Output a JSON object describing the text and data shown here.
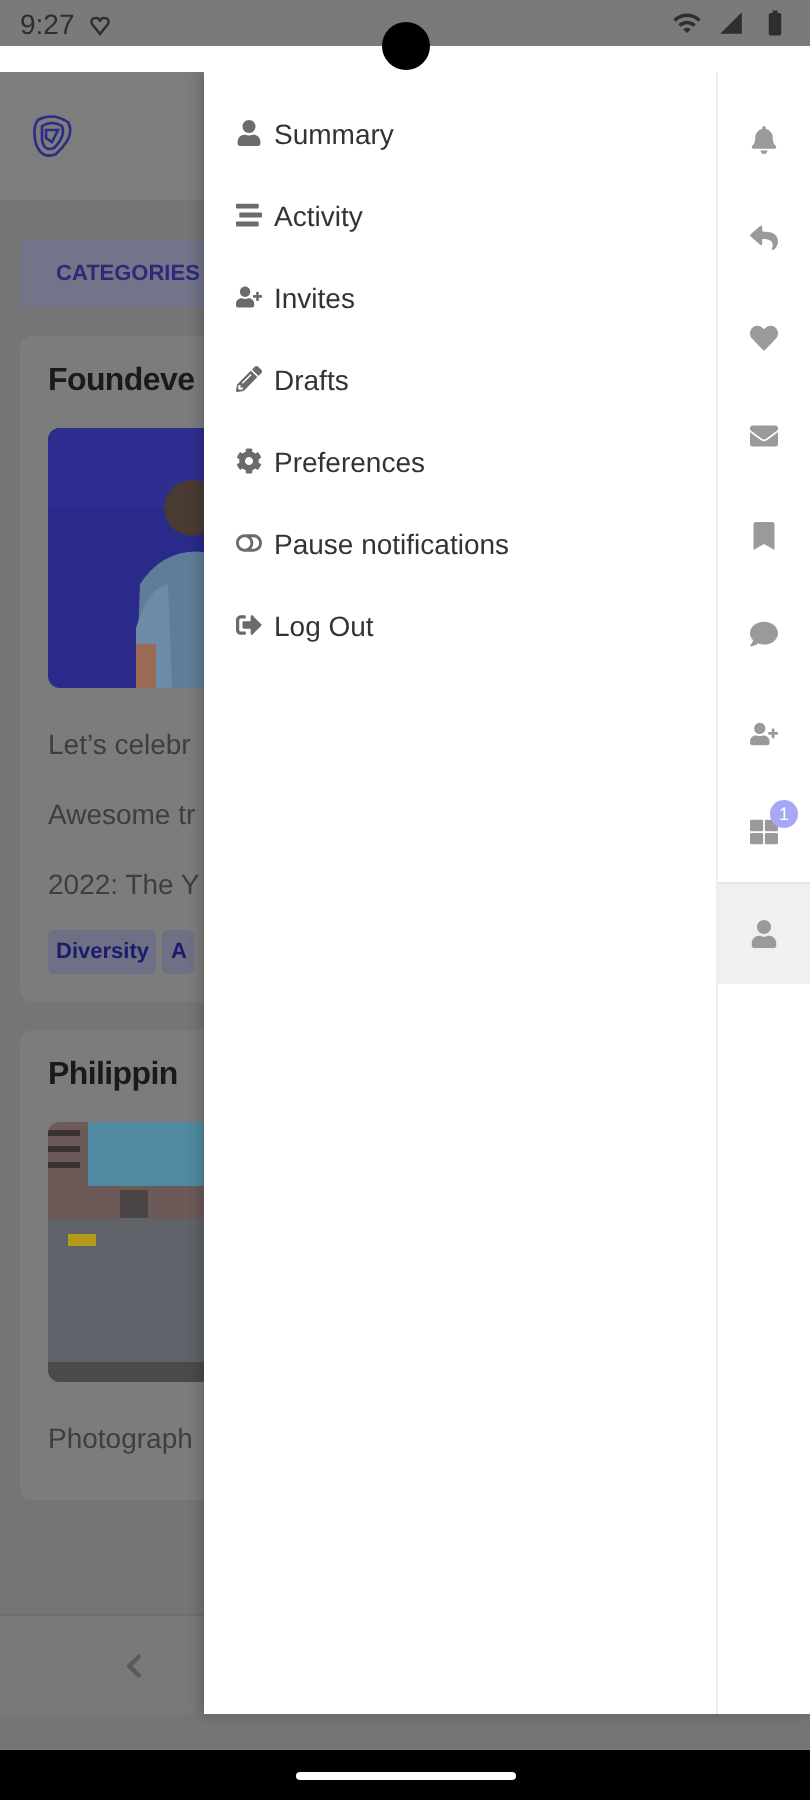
{
  "status_bar": {
    "time": "9:27"
  },
  "background_app": {
    "categories_button": "CATEGORIES",
    "posts": [
      {
        "title": "Foundeve",
        "lines": [
          "Let’s celebr",
          "Awesome tr",
          "2022: The Y"
        ],
        "tags": [
          "Diversity",
          "A"
        ]
      },
      {
        "title": "Philippin",
        "lines": [
          "Photograph"
        ]
      }
    ]
  },
  "menu": {
    "items": [
      {
        "label": "Summary",
        "kind": "user"
      },
      {
        "label": "Activity",
        "kind": "lines"
      },
      {
        "label": "Invites",
        "kind": "user-plus"
      },
      {
        "label": "Drafts",
        "kind": "pencil"
      },
      {
        "label": "Preferences",
        "kind": "gear"
      },
      {
        "label": "Pause notifications",
        "kind": "toggle"
      },
      {
        "label": "Log Out",
        "kind": "logout"
      }
    ]
  },
  "rail": {
    "items": [
      {
        "kind": "bell",
        "selected": false
      },
      {
        "kind": "reply",
        "selected": false
      },
      {
        "kind": "heart",
        "selected": false
      },
      {
        "kind": "envelope",
        "selected": false
      },
      {
        "kind": "bookmark",
        "selected": false
      },
      {
        "kind": "comment",
        "selected": false
      },
      {
        "kind": "user-plus",
        "selected": false
      },
      {
        "kind": "apps",
        "selected": false,
        "badge": "1"
      },
      {
        "kind": "user",
        "selected": true
      }
    ]
  }
}
